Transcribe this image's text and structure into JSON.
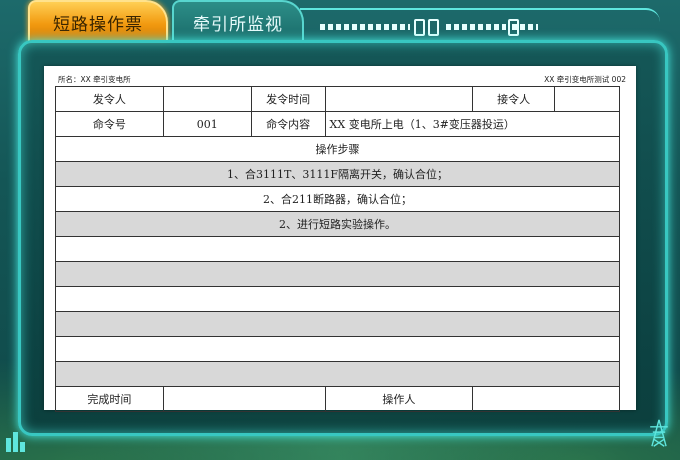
{
  "tabs": {
    "active": "短路操作票",
    "inactive": "牵引所监视"
  },
  "sheet": {
    "header_left": "所名：XX 牵引变电所",
    "header_right": "XX 牵引变电所测试 002",
    "labels": {
      "issuer": "发令人",
      "issue_time": "发令时间",
      "receiver": "接令人",
      "command_no": "命令号",
      "command_content": "命令内容",
      "steps_title": "操作步骤",
      "complete_time": "完成时间",
      "operator": "操作人"
    },
    "values": {
      "issuer": "",
      "issue_time": "",
      "receiver": "",
      "command_no": "001",
      "command_content": "XX 变电所上电（1、3#变压器投运）",
      "complete_time": "",
      "operator": ""
    },
    "steps": [
      "1、合3111T、3111F隔离开关，确认合位；",
      "2、合211断路器，确认合位；",
      "2、进行短路实验操作。",
      "",
      "",
      "",
      "",
      "",
      ""
    ]
  },
  "icons": [
    "chart-icon",
    "power-tower-icon"
  ],
  "colors": {
    "frame": "#38c7c1",
    "active_tab": "#f29a10",
    "inactive_tab": "#1a6a68",
    "row_gray": "#d8d8d8"
  }
}
